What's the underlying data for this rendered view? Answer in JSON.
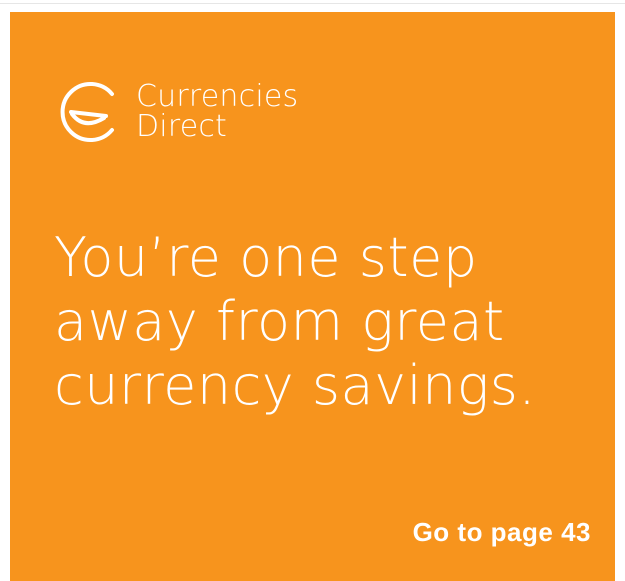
{
  "brand": {
    "name_line1": "Currencies",
    "name_line2": "Direct",
    "logo_icon": "smile-c-logo-icon"
  },
  "headline": "You’re one step\naway from great\ncurrency savings.",
  "cta": {
    "label": "Go to page 43"
  },
  "colors": {
    "background": "#f7941d",
    "text": "#ffffff"
  }
}
